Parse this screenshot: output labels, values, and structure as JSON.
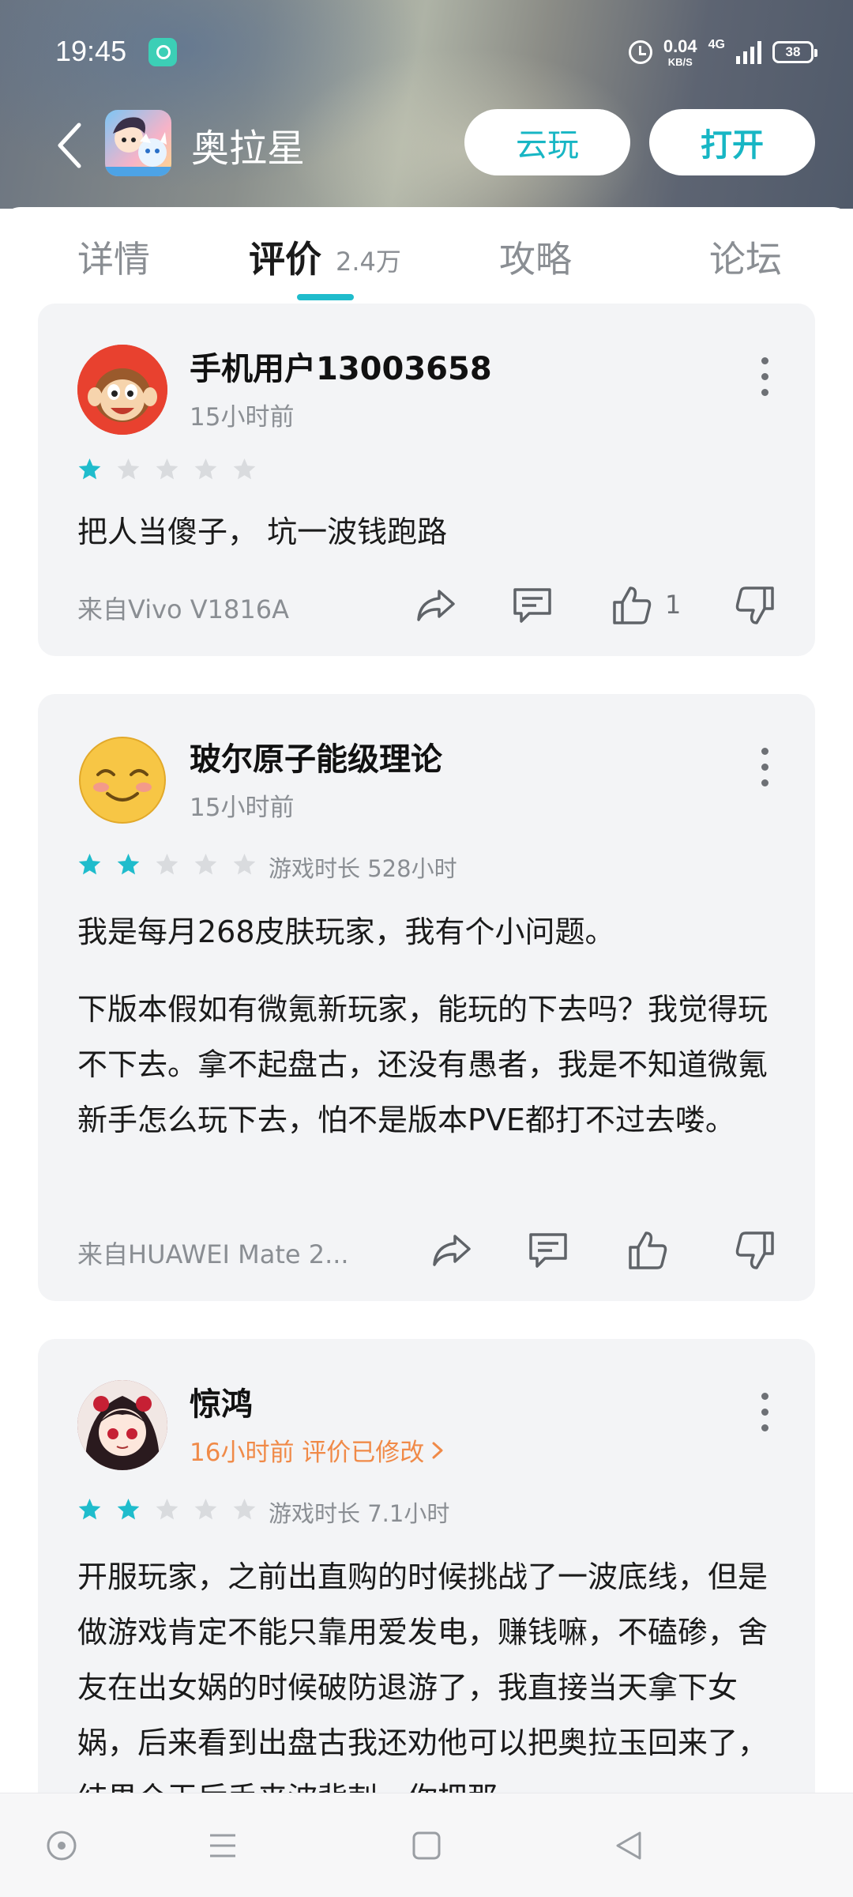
{
  "status_bar": {
    "time": "19:45",
    "net_speed_value": "0.04",
    "net_speed_unit": "KB/S",
    "network_type": "4G",
    "battery": "38"
  },
  "app_bar": {
    "app_name": "奥拉星",
    "cloud_play_label": "云玩",
    "open_label": "打开"
  },
  "tabs": [
    {
      "label": "详情"
    },
    {
      "label": "评价",
      "count": "2.4万",
      "active": true
    },
    {
      "label": "攻略"
    },
    {
      "label": "论坛"
    }
  ],
  "reviews": [
    {
      "username": "手机用户13003658",
      "time": "15小时前",
      "rating": 1,
      "playtime": "",
      "paragraphs": [
        "把人当傻子， 坑一波钱跑路"
      ],
      "device": "来自Vivo V1816A",
      "likes": "1"
    },
    {
      "username": "玻尔原子能级理论",
      "time": "15小时前",
      "rating": 2,
      "playtime": "游戏时长 528小时",
      "paragraphs": [
        "我是每月268皮肤玩家，我有个小问题。",
        "下版本假如有微氪新玩家，能玩的下去吗？我觉得玩不下去。拿不起盘古，还没有愚者，我是不知道微氪新手怎么玩下去，怕不是版本PVE都打不过去喽。"
      ],
      "device": "来自HUAWEI Mate 2...",
      "likes": ""
    },
    {
      "username": "惊鸿",
      "time": "16小时前 评价已修改",
      "rating": 2,
      "playtime": "游戏时长 7.1小时",
      "paragraphs": [
        "开服玩家，之前出直购的时候挑战了一波底线，但是做游戏肯定不能只靠用爱发电，赚钱嘛，不磕碜，舍友在出女娲的时候破防退游了，我直接当天拿下女娲，后来看到出盘古我还劝他可以把奥拉玉回来了，结果仓玉后手来波背刺，你把那"
      ],
      "device": "",
      "likes": ""
    }
  ],
  "colors": {
    "accent": "#1fbccc",
    "star_on": "#1fbccc",
    "star_off": "#d9dbde",
    "edited": "#f08a48",
    "card_bg": "#f3f4f6"
  },
  "icons": [
    "back-icon",
    "share-icon",
    "comment-icon",
    "like-icon",
    "dislike-icon",
    "more-icon",
    "star-icon",
    "chevron-right-icon"
  ]
}
